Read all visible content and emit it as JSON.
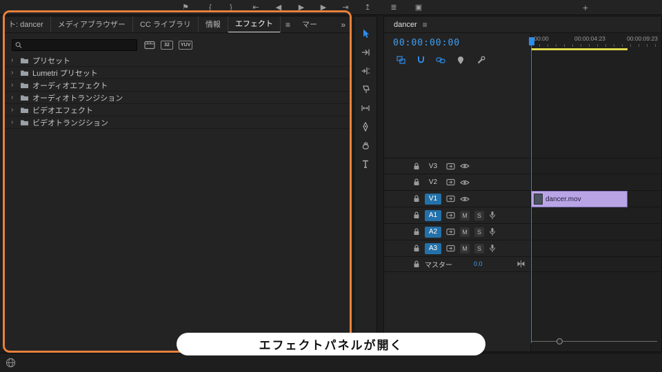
{
  "ui": {
    "menu": "≡",
    "overflow": "»",
    "chevron": "›"
  },
  "top_toolbar": {
    "icons": {
      "marker": "⚑",
      "mark_in": "{",
      "mark_out": "}",
      "go_to_in": "⇤",
      "step_back": "◀",
      "play": "▶",
      "step_forward": "▶",
      "go_to_out": "⇥",
      "lift": "↥",
      "extract": "↧",
      "export": "≣",
      "camera": "▣",
      "add": "+"
    }
  },
  "effects_panel": {
    "tabs": [
      {
        "label": "ト: dancer",
        "active": false
      },
      {
        "label": "メディアブラウザー",
        "active": false
      },
      {
        "label": "CC ライブラリ",
        "active": false
      },
      {
        "label": "情報",
        "active": false
      },
      {
        "label": "エフェクト",
        "active": true
      },
      {
        "label": "マー",
        "active": false
      }
    ],
    "search_placeholder": "",
    "search_value": "",
    "filters": {
      "bit32_label": "32",
      "yuv_label": "YUV"
    },
    "items": [
      "プリセット",
      "Lumetri プリセット",
      "オーディオエフェクト",
      "オーディオトランジション",
      "ビデオエフェクト",
      "ビデオトランジション"
    ]
  },
  "timeline": {
    "tab_label": "dancer",
    "timecode": "00:00:00:00",
    "ruler_labels": [
      ":00:00",
      "00:00:04:23",
      "00:00:09:23"
    ],
    "video_tracks": [
      "V3",
      "V2",
      "V1"
    ],
    "audio_tracks": [
      "A1",
      "A2",
      "A3"
    ],
    "audio_buttons": {
      "mute": "M",
      "solo": "S"
    },
    "master": {
      "label": "マスター",
      "value": "0.0"
    },
    "clip": {
      "name": "dancer.mov"
    }
  },
  "caption": "エフェクトパネルが開く",
  "colors": {
    "accent_blue": "#2d8ceb",
    "highlight_orange": "#e8813c",
    "clip_purple": "#b9a5e6",
    "render_bar_yellow": "#e0d94f"
  }
}
